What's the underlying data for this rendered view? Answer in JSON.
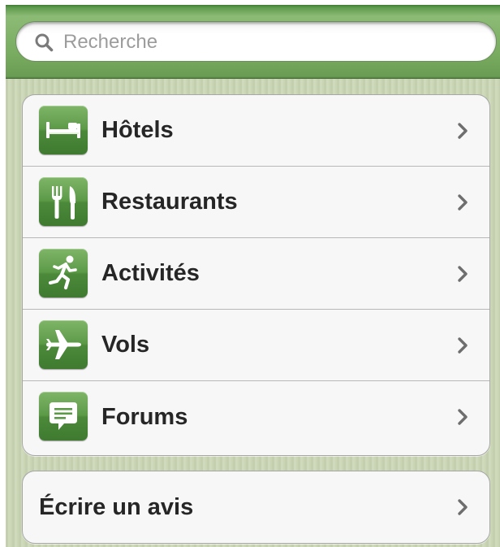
{
  "search": {
    "placeholder": "Recherche"
  },
  "menu": {
    "items": [
      {
        "label": "Hôtels",
        "icon": "bed-icon"
      },
      {
        "label": "Restaurants",
        "icon": "fork-knife-icon"
      },
      {
        "label": "Activités",
        "icon": "running-person-icon"
      },
      {
        "label": "Vols",
        "icon": "airplane-icon"
      },
      {
        "label": "Forums",
        "icon": "speech-bubble-icon"
      }
    ]
  },
  "review": {
    "label": "Écrire un avis"
  },
  "colors": {
    "header_green": "#79ab61",
    "icon_green": "#5c9a48",
    "background": "#c8d4b4",
    "label_text": "#262626",
    "placeholder_text": "#9c9c9c",
    "chevron": "#6e6e6e"
  }
}
